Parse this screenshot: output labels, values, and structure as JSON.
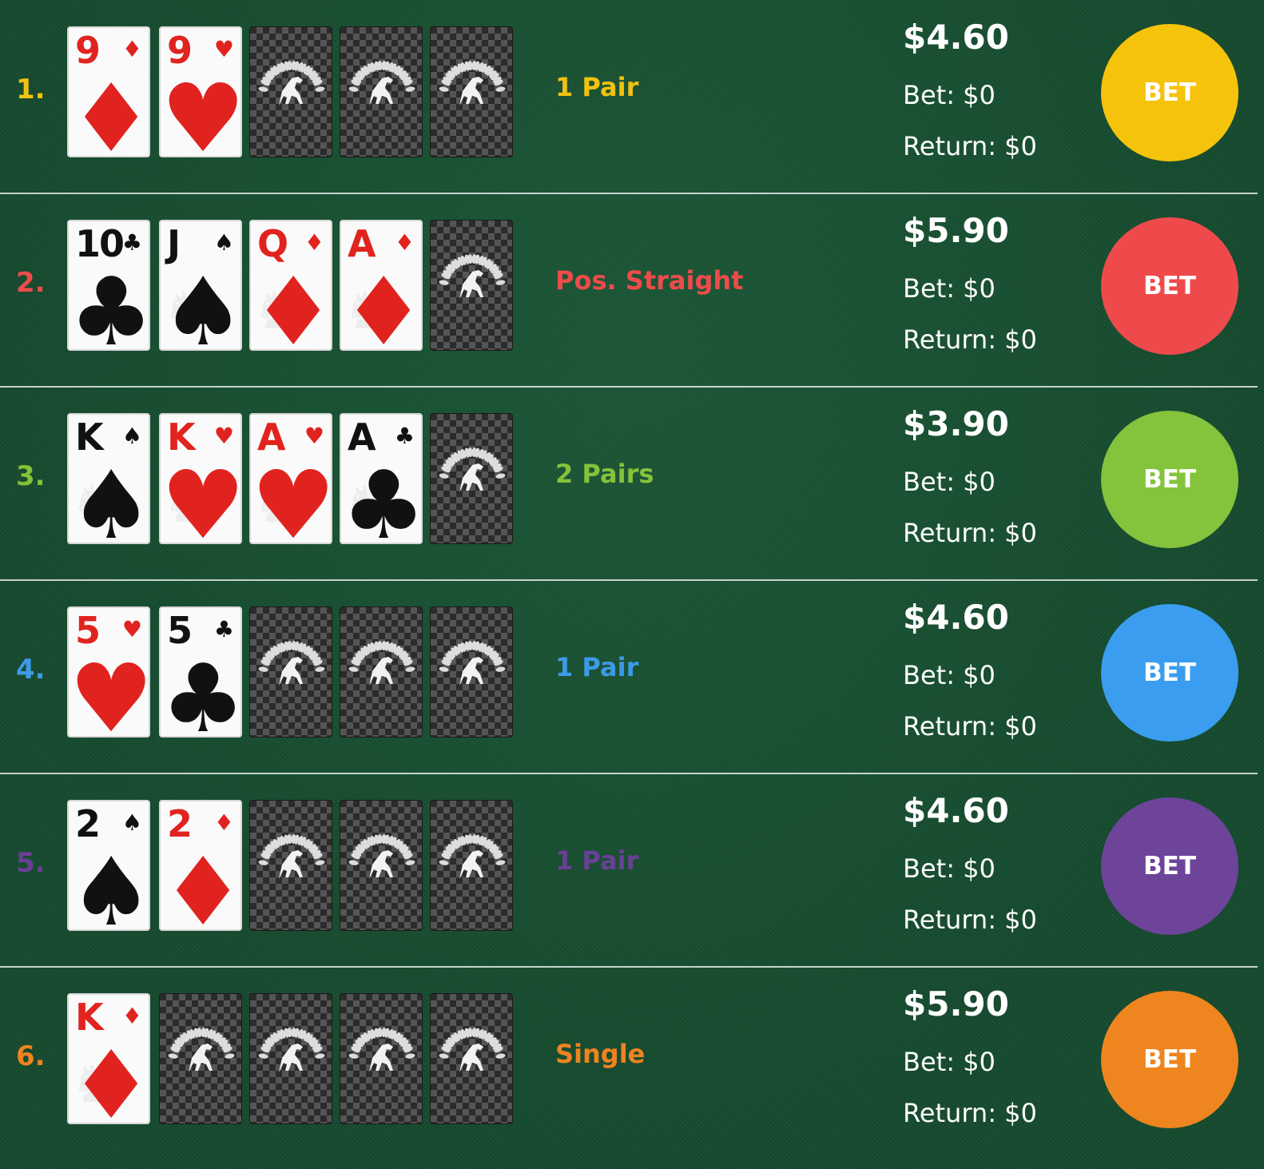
{
  "labels": {
    "bet_prefix": "Bet: ",
    "return_prefix": "Return: ",
    "button": "BET"
  },
  "rows": [
    {
      "rank": "1.",
      "color": "#f2c10f",
      "hand": "1 Pair",
      "odds": "$4.60",
      "bet": "$0",
      "return": "$0",
      "cards": [
        {
          "face": true,
          "rank": "9",
          "suit": "♦",
          "color": "red",
          "figure": false
        },
        {
          "face": true,
          "rank": "9",
          "suit": "♥",
          "color": "red",
          "figure": false
        },
        {
          "face": false
        },
        {
          "face": false
        },
        {
          "face": false
        }
      ]
    },
    {
      "rank": "2.",
      "color": "#ee4b4b",
      "hand": "Pos. Straight",
      "odds": "$5.90",
      "bet": "$0",
      "return": "$0",
      "cards": [
        {
          "face": true,
          "rank": "10",
          "suit": "♣",
          "color": "black",
          "figure": false
        },
        {
          "face": true,
          "rank": "J",
          "suit": "♠",
          "color": "black",
          "figure": true
        },
        {
          "face": true,
          "rank": "Q",
          "suit": "♦",
          "color": "red",
          "figure": true
        },
        {
          "face": true,
          "rank": "A",
          "suit": "♦",
          "color": "red",
          "figure": true
        },
        {
          "face": false
        }
      ]
    },
    {
      "rank": "3.",
      "color": "#84c23a",
      "hand": "2 Pairs",
      "odds": "$3.90",
      "bet": "$0",
      "return": "$0",
      "cards": [
        {
          "face": true,
          "rank": "K",
          "suit": "♠",
          "color": "black",
          "figure": true
        },
        {
          "face": true,
          "rank": "K",
          "suit": "♥",
          "color": "red",
          "figure": true
        },
        {
          "face": true,
          "rank": "A",
          "suit": "♥",
          "color": "red",
          "figure": true
        },
        {
          "face": true,
          "rank": "A",
          "suit": "♣",
          "color": "black",
          "figure": true
        },
        {
          "face": false
        }
      ]
    },
    {
      "rank": "4.",
      "color": "#3d9ae8",
      "hand": "1 Pair",
      "odds": "$4.60",
      "bet": "$0",
      "return": "$0",
      "cards": [
        {
          "face": true,
          "rank": "5",
          "suit": "♥",
          "color": "red",
          "figure": false
        },
        {
          "face": true,
          "rank": "5",
          "suit": "♣",
          "color": "black",
          "figure": false
        },
        {
          "face": false
        },
        {
          "face": false
        },
        {
          "face": false
        }
      ]
    },
    {
      "rank": "5.",
      "color": "#6a3f96",
      "hand": "1 Pair",
      "odds": "$4.60",
      "bet": "$0",
      "return": "$0",
      "cards": [
        {
          "face": true,
          "rank": "2",
          "suit": "♠",
          "color": "black",
          "figure": false
        },
        {
          "face": true,
          "rank": "2",
          "suit": "♦",
          "color": "red",
          "figure": false
        },
        {
          "face": false
        },
        {
          "face": false
        },
        {
          "face": false
        }
      ]
    },
    {
      "rank": "6.",
      "color": "#ee8320",
      "hand": "Single",
      "odds": "$5.90",
      "bet": "$0",
      "return": "$0",
      "cards": [
        {
          "face": true,
          "rank": "K",
          "suit": "♦",
          "color": "red",
          "figure": true
        },
        {
          "face": false
        },
        {
          "face": false
        },
        {
          "face": false
        },
        {
          "face": false
        }
      ]
    }
  ],
  "button_colors": [
    "#f5c30c",
    "#ef4a4b",
    "#84c33c",
    "#3b9df0",
    "#6d449a",
    "#ef851f"
  ]
}
